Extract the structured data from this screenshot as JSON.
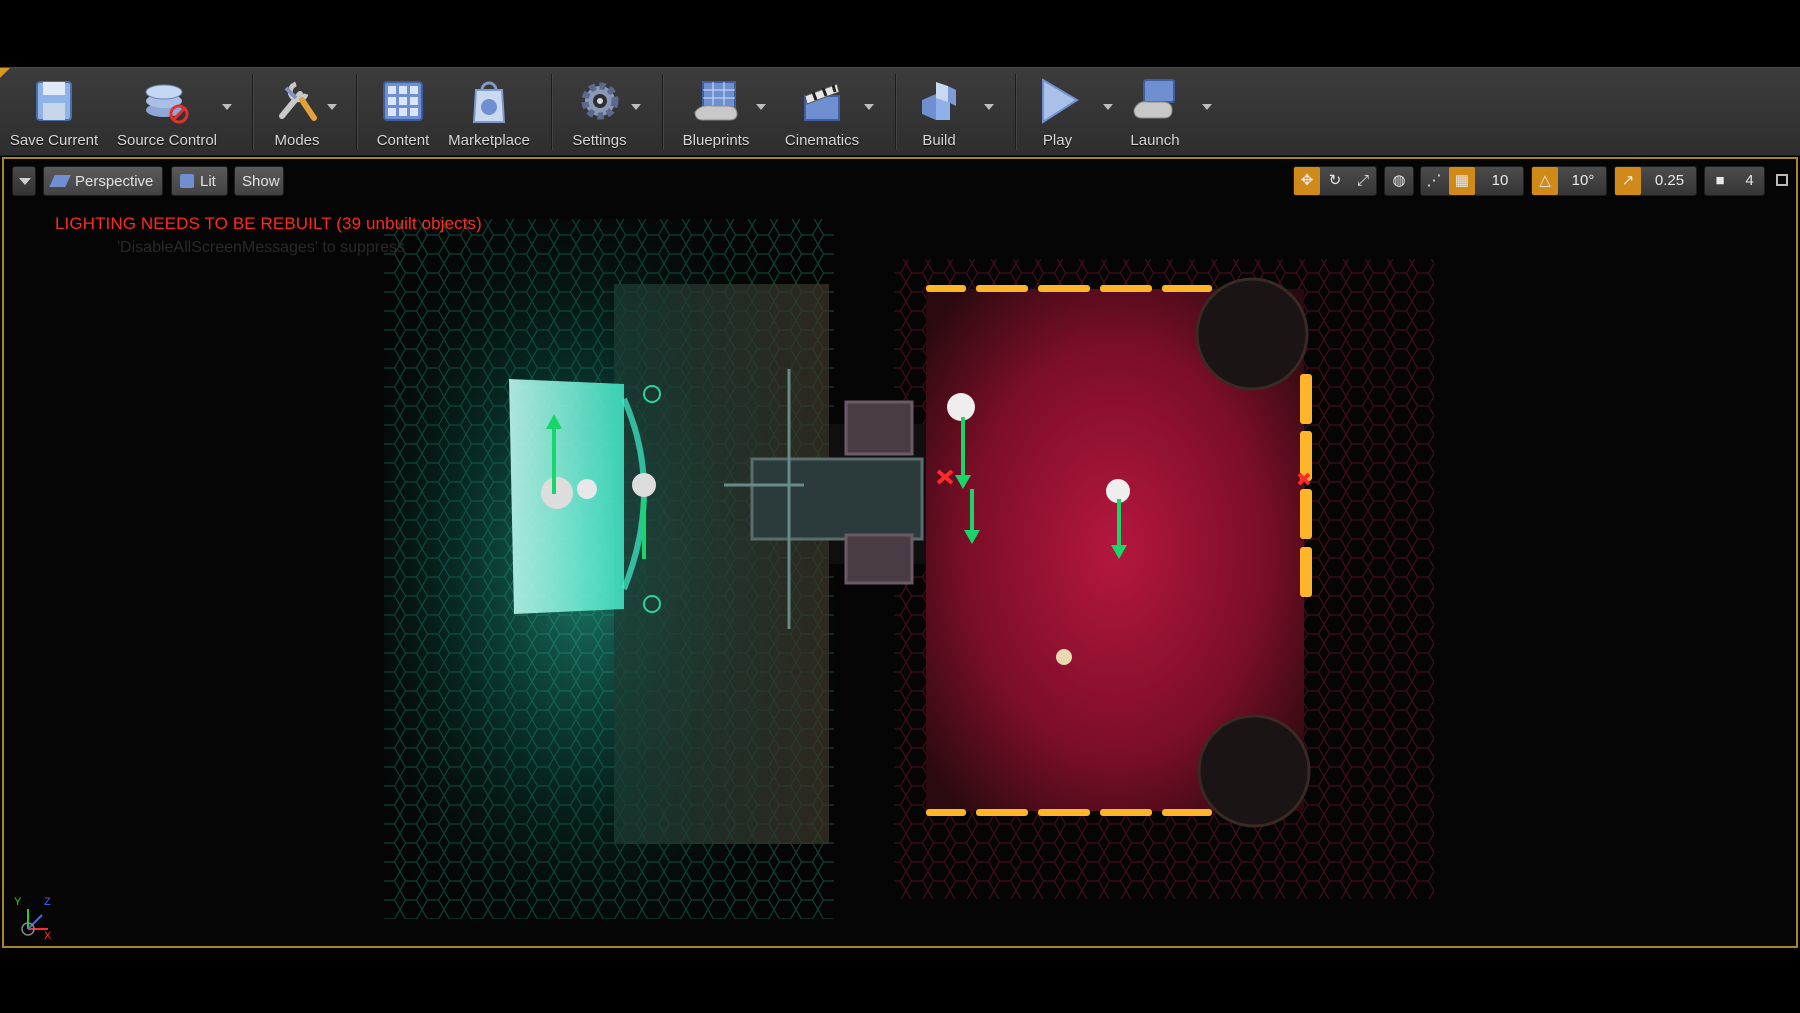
{
  "toolbar": {
    "buttons": [
      {
        "label": "Save Current",
        "icon": "save-icon"
      },
      {
        "label": "Source Control",
        "icon": "source-control-icon"
      },
      {
        "label": "Modes",
        "icon": "modes-icon"
      },
      {
        "label": "Content",
        "icon": "content-icon"
      },
      {
        "label": "Marketplace",
        "icon": "marketplace-icon"
      },
      {
        "label": "Settings",
        "icon": "settings-icon"
      },
      {
        "label": "Blueprints",
        "icon": "blueprints-icon"
      },
      {
        "label": "Cinematics",
        "icon": "cinematics-icon"
      },
      {
        "label": "Build",
        "icon": "build-icon"
      },
      {
        "label": "Play",
        "icon": "play-icon"
      },
      {
        "label": "Launch",
        "icon": "launch-icon"
      }
    ]
  },
  "viewport": {
    "perspective_label": "Perspective",
    "lit_label": "Lit",
    "show_label": "Show",
    "grid_snap": "10",
    "rotation_snap": "10°",
    "scale_snap": "0.25",
    "camera_speed": "4",
    "lighting_message": "LIGHTING NEEDS TO BE REBUILT (39 unbuilt objects)",
    "suppress_message": "'DisableAllScreenMessages' to suppress",
    "axis_labels": {
      "y": "Y",
      "z": "Z",
      "x": "X"
    }
  },
  "colors": {
    "accent": "#d08a1a",
    "warning_text": "#ff2a1e",
    "teal_room": "#1fd6b0",
    "red_room": "#c0123a",
    "toolbar_bg": "#333333"
  }
}
